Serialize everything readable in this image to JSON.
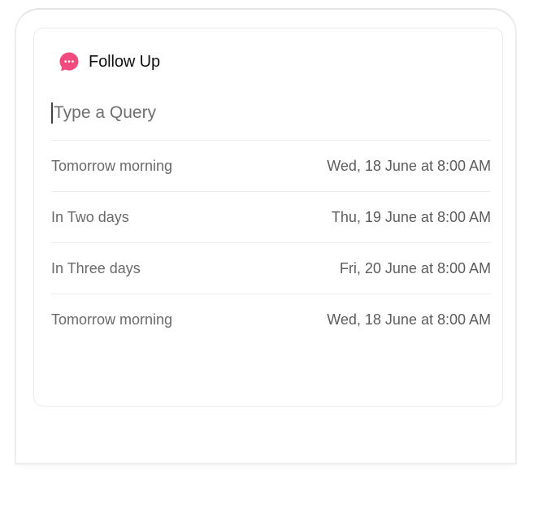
{
  "accent_color": "#ef4b7f",
  "header": {
    "title": "Follow Up",
    "icon": "chat-bubble-icon"
  },
  "search": {
    "placeholder": "Type a Query",
    "value": ""
  },
  "options": [
    {
      "label": "Tomorrow morning",
      "date": "Wed, 18 June at 8:00 AM"
    },
    {
      "label": "In Two days",
      "date": "Thu, 19 June at 8:00 AM"
    },
    {
      "label": "In Three days",
      "date": "Fri, 20 June at 8:00 AM"
    },
    {
      "label": "Tomorrow morning",
      "date": "Wed, 18 June at 8:00 AM"
    }
  ]
}
